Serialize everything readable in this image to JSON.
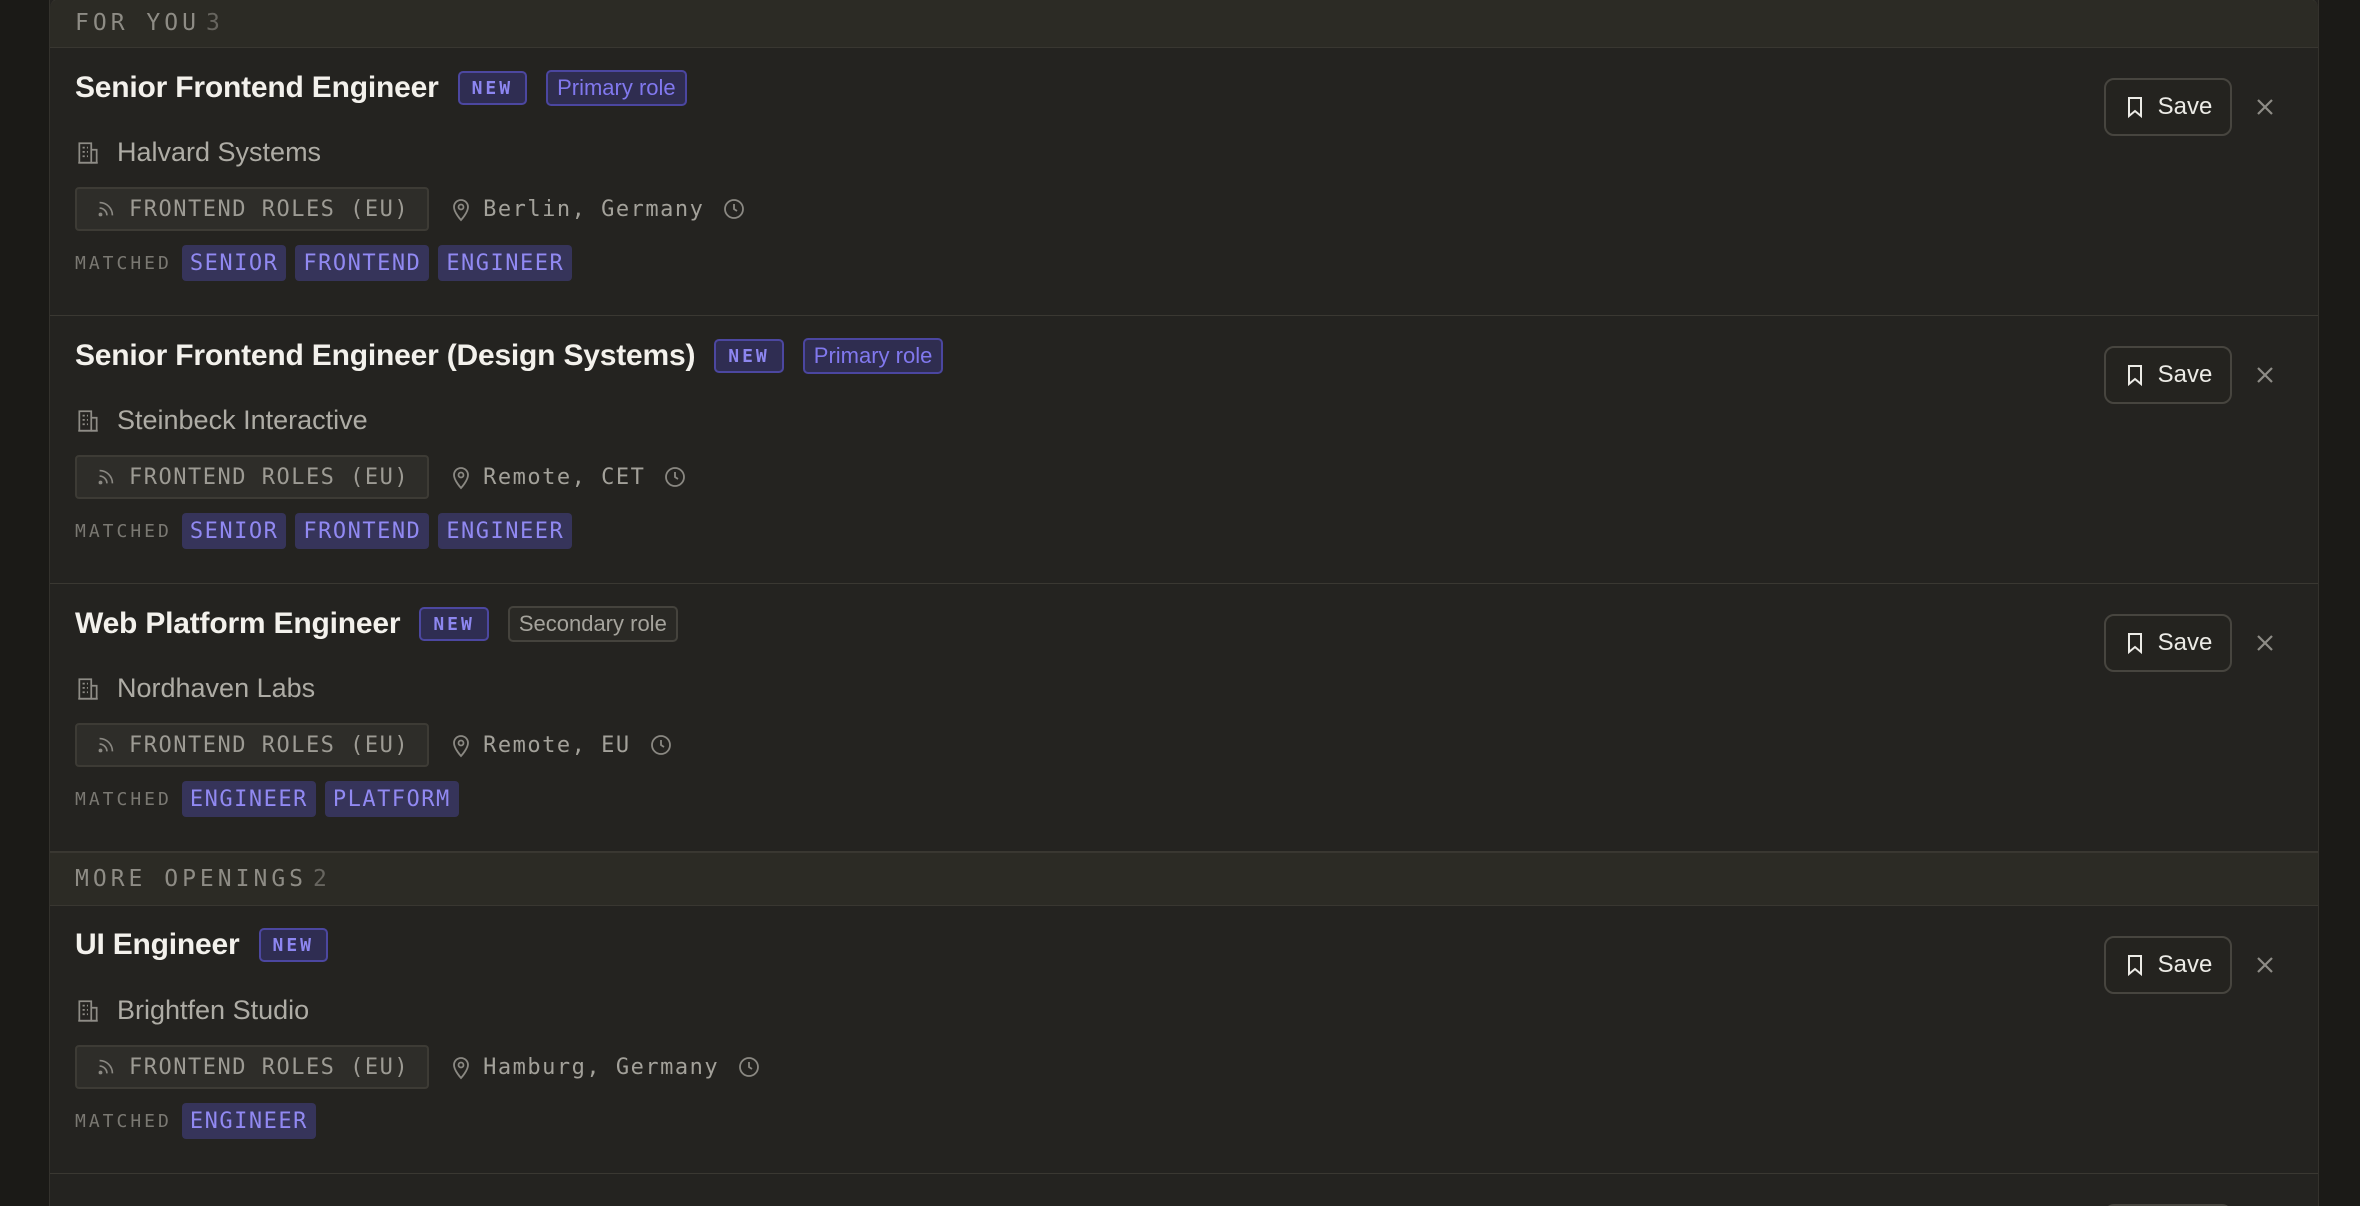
{
  "sections": [
    {
      "label": "FOR YOU",
      "count": "3",
      "jobs": [
        {
          "title": "Senior Frontend Engineer",
          "badge_new": "NEW",
          "role": "Primary role",
          "role_type": "primary",
          "company": "Halvard Systems",
          "feed": "FRONTEND ROLES (EU)",
          "location": "Berlin, Germany",
          "matched_label": "MATCHED",
          "keywords": [
            "SENIOR",
            "FRONTEND",
            "ENGINEER"
          ],
          "save_label": "Save"
        },
        {
          "title": "Senior Frontend Engineer (Design Systems)",
          "badge_new": "NEW",
          "role": "Primary role",
          "role_type": "primary",
          "company": "Steinbeck Interactive",
          "feed": "FRONTEND ROLES (EU)",
          "location": "Remote, CET",
          "matched_label": "MATCHED",
          "keywords": [
            "SENIOR",
            "FRONTEND",
            "ENGINEER"
          ],
          "save_label": "Save"
        },
        {
          "title": "Web Platform Engineer",
          "badge_new": "NEW",
          "role": "Secondary role",
          "role_type": "secondary",
          "company": "Nordhaven Labs",
          "feed": "FRONTEND ROLES (EU)",
          "location": "Remote, EU",
          "matched_label": "MATCHED",
          "keywords": [
            "ENGINEER",
            "PLATFORM"
          ],
          "save_label": "Save"
        }
      ]
    },
    {
      "label": "MORE OPENINGS",
      "count": "2",
      "jobs": [
        {
          "title": "UI Engineer",
          "badge_new": "NEW",
          "role": null,
          "company": "Brightfen Studio",
          "feed": "FRONTEND ROLES (EU)",
          "location": "Hamburg, Germany",
          "matched_label": "MATCHED",
          "keywords": [
            "ENGINEER"
          ],
          "save_label": "Save"
        }
      ]
    }
  ],
  "icons": {
    "company": "building-icon",
    "feed": "rss-icon",
    "location": "map-pin-icon",
    "time": "clock-icon",
    "save": "bookmark-icon",
    "dismiss": "close-icon"
  },
  "colors": {
    "background": "#1b1a17",
    "panel": "#242320",
    "accent": "#8d86f0",
    "keyword_bg": "#36345a"
  }
}
